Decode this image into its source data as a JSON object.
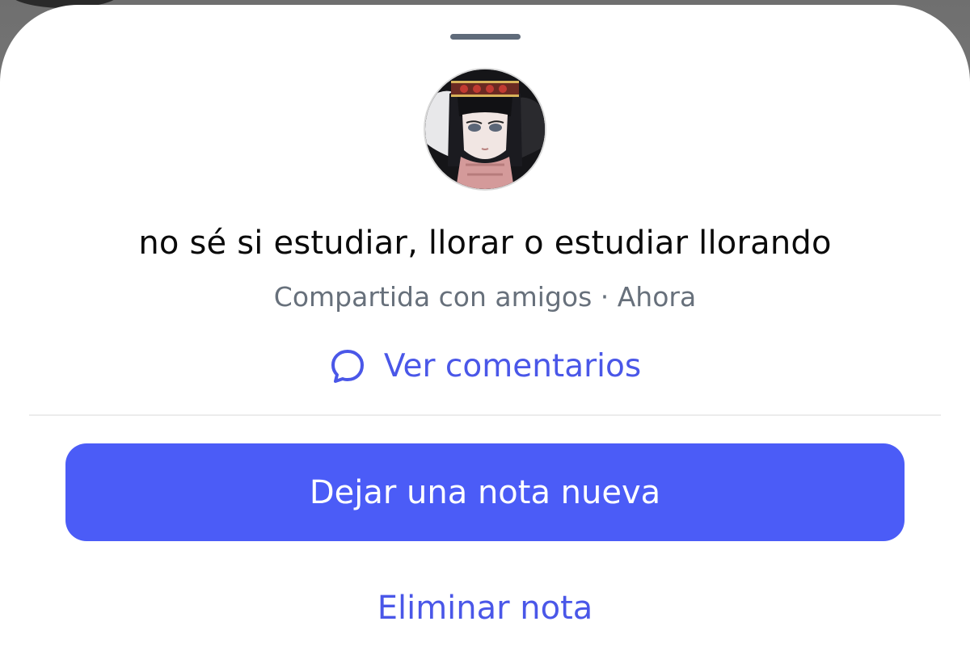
{
  "note": {
    "text": "no sé si estudiar, llorar o estudiar llorando",
    "meta": "Compartida con amigos · Ahora"
  },
  "actions": {
    "comments_label": "Ver comentarios",
    "primary_label": "Dejar una nota nueva",
    "delete_label": "Eliminar nota"
  },
  "icons": {
    "comments": "comment-bubble-icon",
    "avatar": "profile-avatar"
  },
  "colors": {
    "accent": "#4b5cf7",
    "link": "#4a57e8",
    "meta_text": "#67707b",
    "handle": "#5f6b7a"
  }
}
